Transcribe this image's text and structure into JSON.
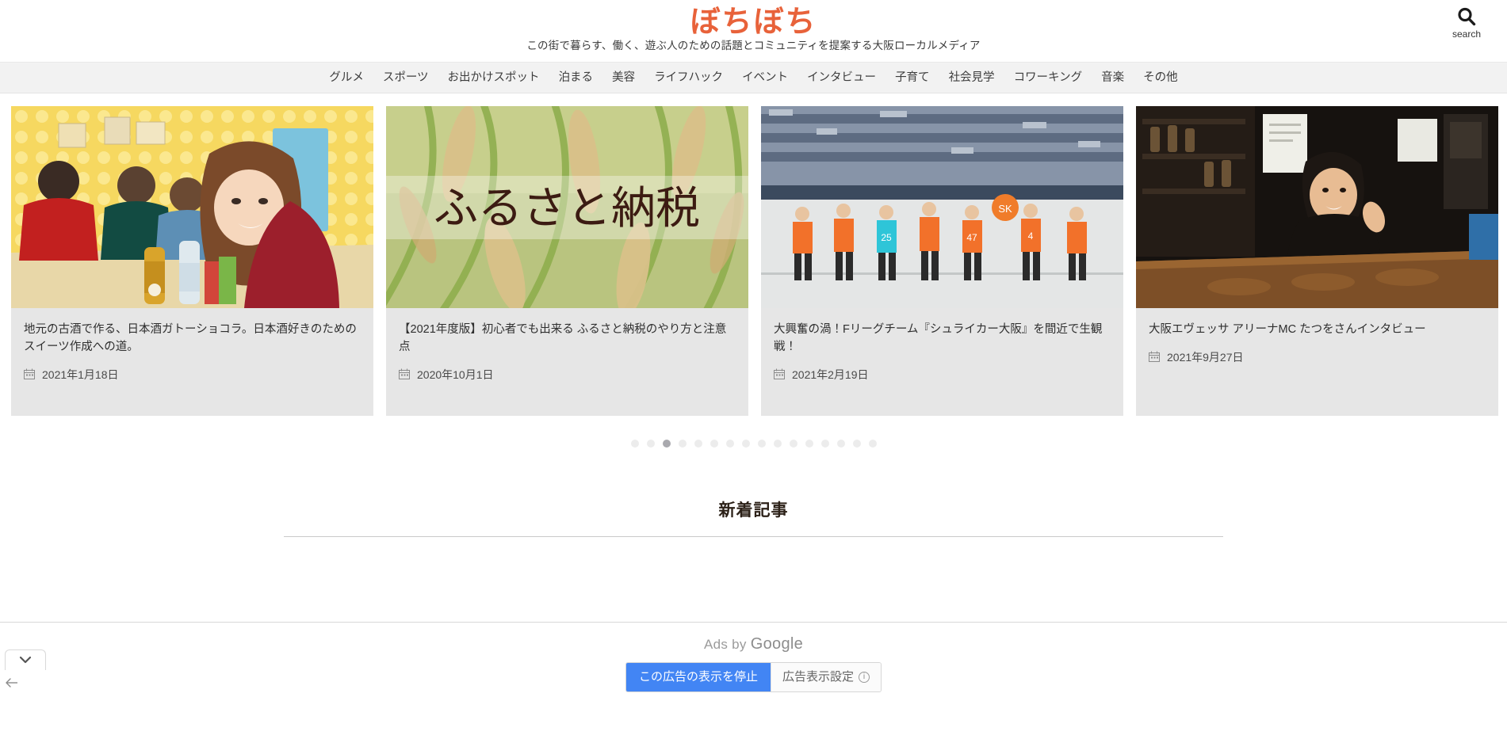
{
  "header": {
    "logo_text": "ぼちぼち",
    "logo_color": "#e8623a",
    "tagline": "この街で暮らす、働く、遊ぶ人のための話題とコミュニティを提案する大阪ローカルメディア",
    "search": {
      "icon": "search-icon",
      "label": "search"
    }
  },
  "nav": {
    "items": [
      {
        "label": "グルメ"
      },
      {
        "label": "スポーツ"
      },
      {
        "label": "お出かけスポット"
      },
      {
        "label": "泊まる"
      },
      {
        "label": "美容"
      },
      {
        "label": "ライフハック"
      },
      {
        "label": "イベント"
      },
      {
        "label": "インタビュー"
      },
      {
        "label": "子育て"
      },
      {
        "label": "社会見学"
      },
      {
        "label": "コワーキング"
      },
      {
        "label": "音楽"
      },
      {
        "label": "その他"
      }
    ]
  },
  "carousel": {
    "slides": [
      {
        "title": "地元の古酒で作る、日本酒ガトーショコラ。日本酒好きのためのスイーツ作成への道。",
        "date": "2021年1月18日",
        "image_alt": "居酒屋で日本酒を囲む人々の写真",
        "image_overlay_text": ""
      },
      {
        "title": "【2021年度版】初心者でも出来る ふるさと納税のやり方と注意点",
        "date": "2020年10月1日",
        "image_alt": "稲穂の写真",
        "image_overlay_text": "ふるさと納税"
      },
      {
        "title": "大興奮の渦！Fリーグチーム『シュライカー大阪』を間近で生観戦！",
        "date": "2021年2月19日",
        "image_alt": "フットサル選手が並ぶ体育館の写真",
        "image_overlay_text": ""
      },
      {
        "title": "大阪エヴェッサ アリーナMC たつをさんインタビュー",
        "date": "2021年9月27日",
        "image_alt": "バーカウンターで話す男性の写真",
        "image_overlay_text": ""
      }
    ],
    "dot_count": 16,
    "active_dot_index": 2,
    "date_icon": "calendar-icon"
  },
  "section": {
    "title": "新着記事"
  },
  "ad_overlay": {
    "ads_by_prefix": "Ads by",
    "ads_by_brand": "Google",
    "stop_button_label": "この広告の表示を停止",
    "settings_button_label": "広告表示設定",
    "info_glyph": "ⓘ",
    "primary_color": "#4285f4"
  },
  "browser_chrome": {
    "expand_tab_icon": "chevron-down-icon",
    "back_arrow_icon": "arrow-left-icon"
  }
}
